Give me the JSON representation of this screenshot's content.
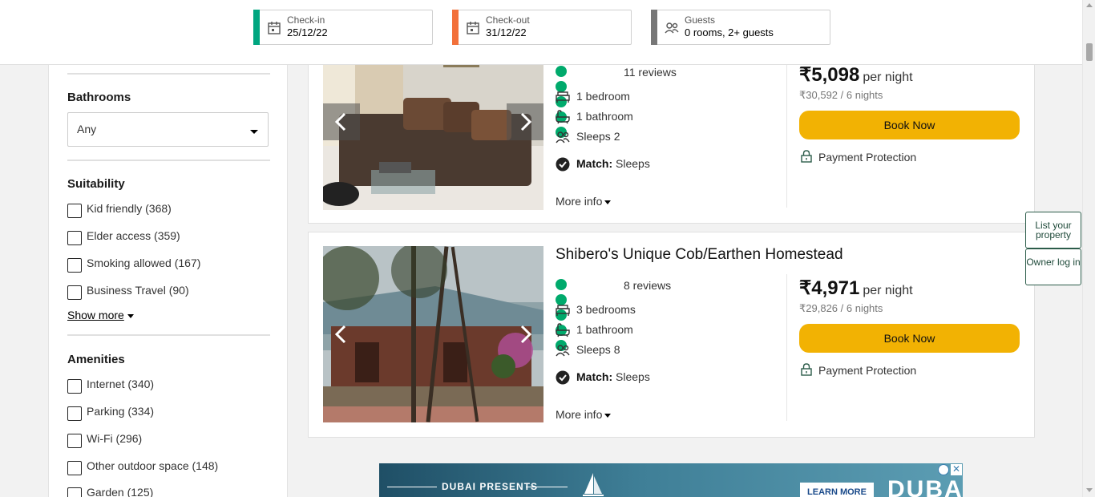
{
  "search": {
    "checkin": {
      "label": "Check-in",
      "value": "25/12/22",
      "color": "#00a680",
      "icon": "calendar-icon"
    },
    "checkout": {
      "label": "Check-out",
      "value": "31/12/22",
      "color": "#f2703a",
      "icon": "calendar-icon"
    },
    "guests": {
      "label": "Guests",
      "value": "0 rooms, 2+ guests",
      "color": "#777777",
      "icon": "people-icon"
    }
  },
  "filters": {
    "bathrooms": {
      "title": "Bathrooms",
      "selected": "Any"
    },
    "suitability": {
      "title": "Suitability",
      "items": [
        {
          "label": "Kid friendly (368)"
        },
        {
          "label": "Elder access (359)"
        },
        {
          "label": "Smoking allowed (167)"
        },
        {
          "label": "Business Travel (90)"
        }
      ],
      "show_more": "Show more"
    },
    "amenities": {
      "title": "Amenities",
      "items": [
        {
          "label": "Internet (340)"
        },
        {
          "label": "Parking (334)"
        },
        {
          "label": "Wi-Fi (296)"
        },
        {
          "label": "Other outdoor space (148)"
        },
        {
          "label": "Garden (125)"
        }
      ]
    }
  },
  "listings": [
    {
      "reviews": "11 reviews",
      "rating_bubbles": 5,
      "bedrooms": "1 bedroom",
      "bathrooms": "1 bathroom",
      "sleeps": "Sleeps 2",
      "match_label": "Match:",
      "match_value": "Sleeps",
      "more_info": "More info",
      "price": "₹5,098",
      "per_night": "per night",
      "total": "₹30,592 / 6 nights",
      "book": "Book Now",
      "protection": "Payment Protection"
    },
    {
      "title": "Shibero's Unique Cob/Earthen Homestead",
      "reviews": "8 reviews",
      "rating_bubbles": 5,
      "bedrooms": "3 bedrooms",
      "bathrooms": "1 bathroom",
      "sleeps": "Sleeps 8",
      "match_label": "Match:",
      "match_value": "Sleeps",
      "more_info": "More info",
      "price": "₹4,971",
      "per_night": "per night",
      "total": "₹29,826 / 6 nights",
      "book": "Book Now",
      "protection": "Payment Protection"
    }
  ],
  "side_buttons": {
    "list_property": "List your property",
    "owner_login": "Owner log in"
  },
  "ad": {
    "headline": "DUBAI PRESENTS",
    "cta": "LEARN MORE",
    "brand": "DUBAI",
    "close": "✕"
  },
  "colors": {
    "accent_green": "#00aa6c",
    "book_button": "#f2b203",
    "owner_border": "#2c5c4a"
  }
}
